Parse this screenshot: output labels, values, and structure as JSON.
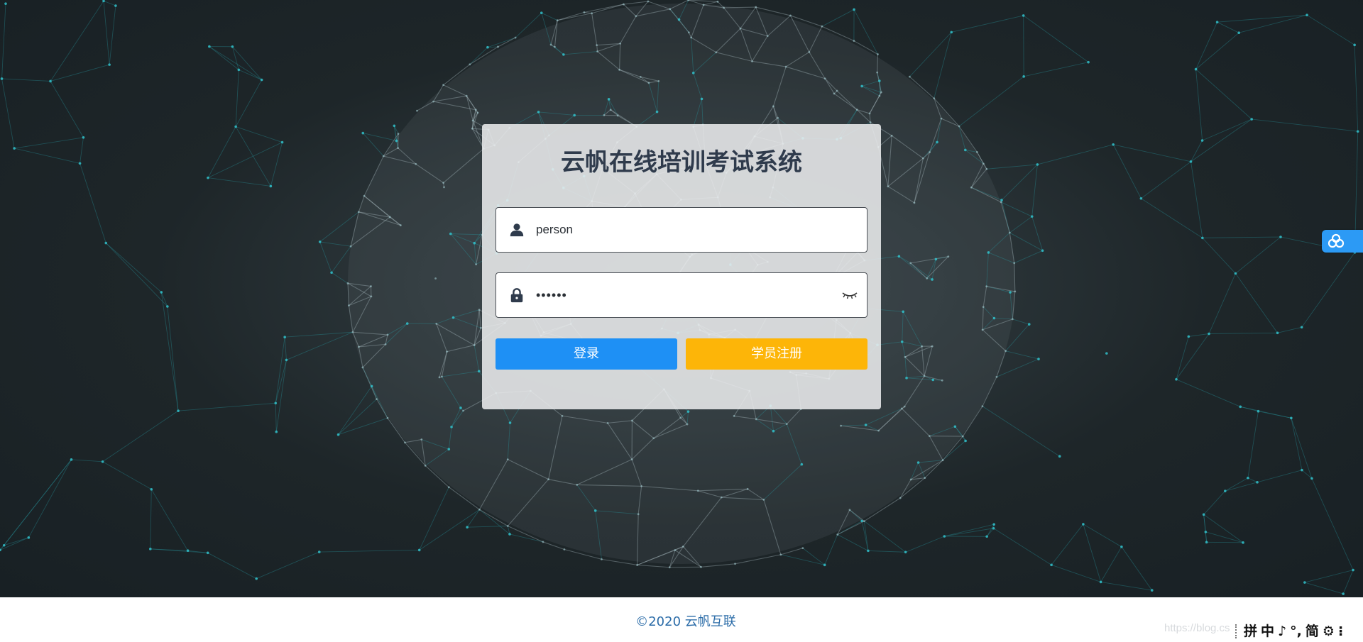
{
  "app": {
    "title": "云帆在线培训考试系统"
  },
  "login_form": {
    "username": {
      "value": "person",
      "icon": "user-icon"
    },
    "password": {
      "masked_value": "••••••",
      "icon": "lock-icon",
      "toggle_icon": "eye-closed-icon"
    },
    "login_button_label": "登录",
    "register_button_label": "学员注册"
  },
  "footer": {
    "copyright": "©2020 云帆互联",
    "watermark": "https://blog.cs"
  },
  "ime_toolbar": {
    "items": [
      "拼",
      "中",
      "♪",
      "°,",
      "简",
      "⚙",
      "⁝"
    ]
  },
  "side_widget": {
    "icon": "cloud-icon"
  },
  "colors": {
    "primary": "#1e90f5",
    "warning": "#fdb508",
    "title": "#2f3b4c",
    "footer_link": "#2b6ca8",
    "background_dark": "#1c2427"
  }
}
